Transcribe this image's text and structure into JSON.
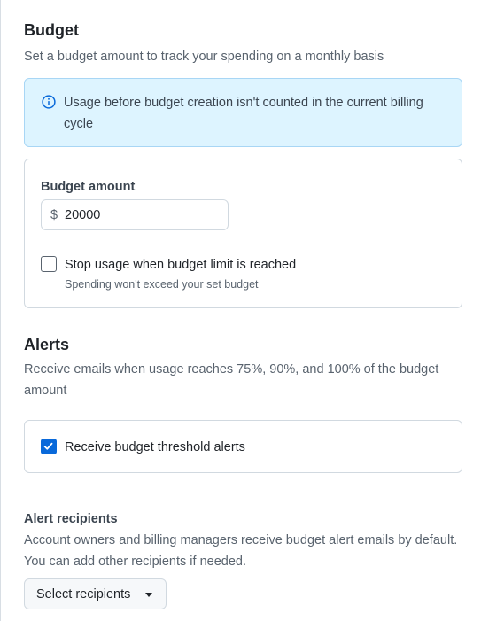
{
  "budget": {
    "title": "Budget",
    "description": "Set a budget amount to track your spending on a monthly basis",
    "info_icon": "info-icon",
    "info_text": "Usage before budget creation isn't counted in the current billing cycle",
    "amount_label": "Budget amount",
    "currency_symbol": "$",
    "amount_value": "20000",
    "stop_usage": {
      "label": "Stop usage when budget limit is reached",
      "hint": "Spending won't exceed your set budget",
      "checked": false
    }
  },
  "alerts": {
    "title": "Alerts",
    "description": "Receive emails when usage reaches 75%, 90%, and 100% of the budget amount",
    "threshold_checkbox": {
      "label": "Receive budget threshold alerts",
      "checked": true
    },
    "recipients_title": "Alert recipients",
    "recipients_description": "Account owners and billing managers receive budget alert emails by default. You can add other recipients if needed.",
    "select_button_label": "Select recipients",
    "select_icon": "triangle-down-icon"
  },
  "colors": {
    "accent": "#0969da",
    "info_bg": "#ddf4ff",
    "info_border": "#a8d6f5"
  }
}
